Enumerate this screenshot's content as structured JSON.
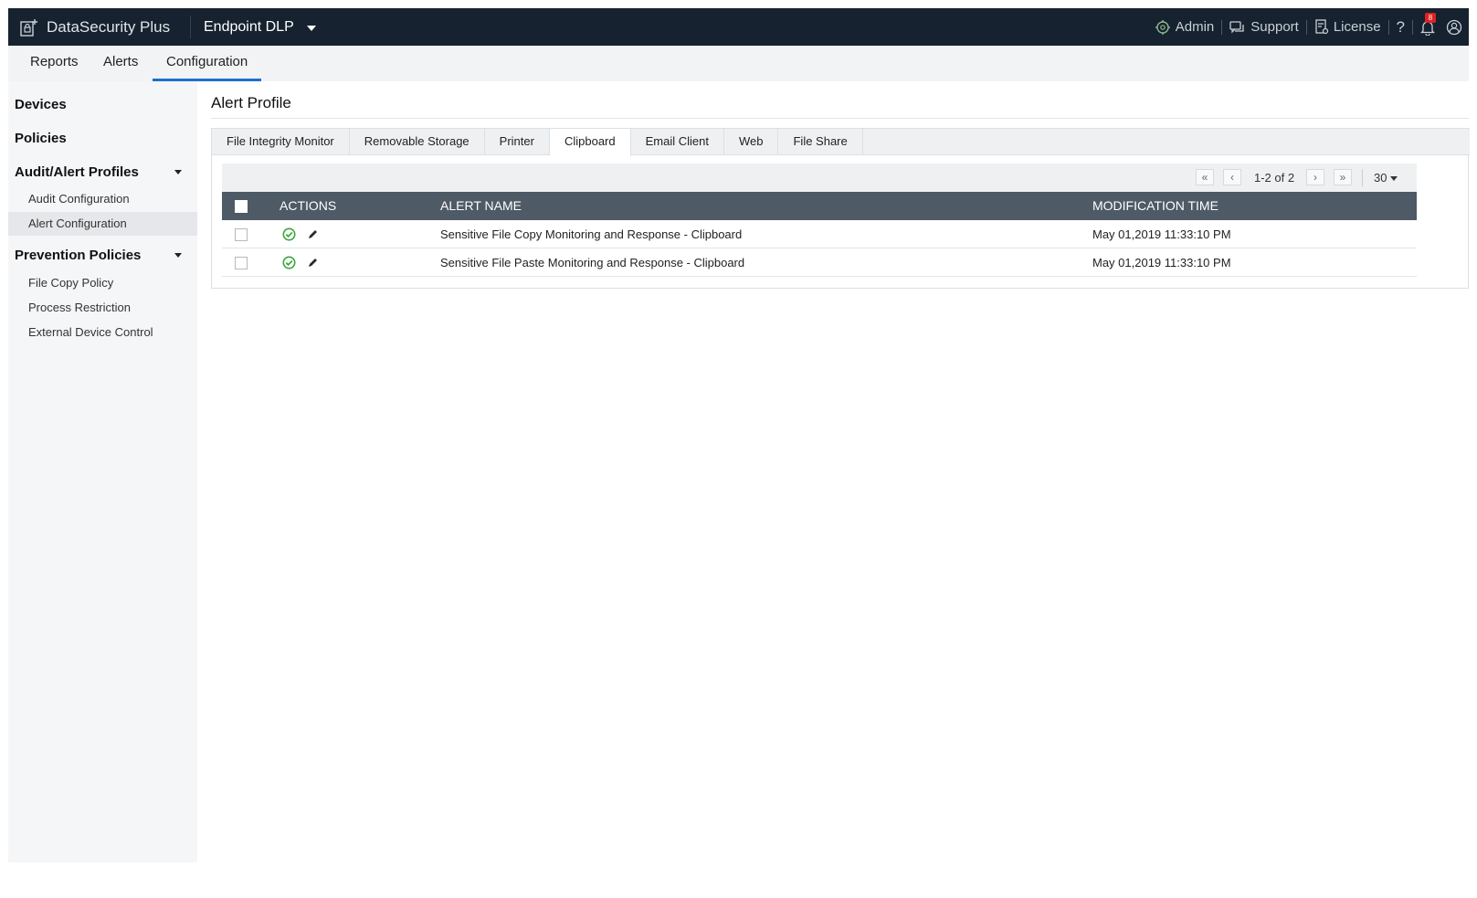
{
  "topbar": {
    "brand": "DataSecurity Plus",
    "product": "Endpoint DLP",
    "links": {
      "admin": "Admin",
      "support": "Support",
      "license": "License",
      "help": "?"
    },
    "notification_count": "8"
  },
  "subnav": {
    "tabs": [
      "Reports",
      "Alerts",
      "Configuration"
    ],
    "active": "Configuration"
  },
  "sidebar": {
    "devices": "Devices",
    "policies": "Policies",
    "audit_alert_profiles": "Audit/Alert Profiles",
    "audit_configuration": "Audit Configuration",
    "alert_configuration": "Alert Configuration",
    "prevention_policies": "Prevention Policies",
    "file_copy_policy": "File Copy Policy",
    "process_restriction": "Process Restriction",
    "external_device_control": "External Device Control"
  },
  "main": {
    "title": "Alert Profile",
    "tabs": [
      "File Integrity Monitor",
      "Removable Storage",
      "Printer",
      "Clipboard",
      "Email Client",
      "Web",
      "File Share"
    ],
    "active_tab": "Clipboard",
    "pager": {
      "range": "1-2 of 2",
      "page_size": "30",
      "first": "«",
      "prev": "‹",
      "next": "›",
      "last": "»"
    },
    "table": {
      "headers": {
        "actions": "ACTIONS",
        "alert_name": "ALERT NAME",
        "modification_time": "MODIFICATION TIME"
      },
      "rows": [
        {
          "alert_name": "Sensitive File Copy Monitoring and Response - Clipboard",
          "modification_time": "May 01,2019 11:33:10 PM"
        },
        {
          "alert_name": "Sensitive File Paste Monitoring and Response - Clipboard",
          "modification_time": "May 01,2019 11:33:10 PM"
        }
      ]
    }
  },
  "colors": {
    "topbar": "#16222f",
    "accent": "#1f6fd0",
    "table_header": "#4e5a66",
    "enabled": "#3aa53a"
  }
}
